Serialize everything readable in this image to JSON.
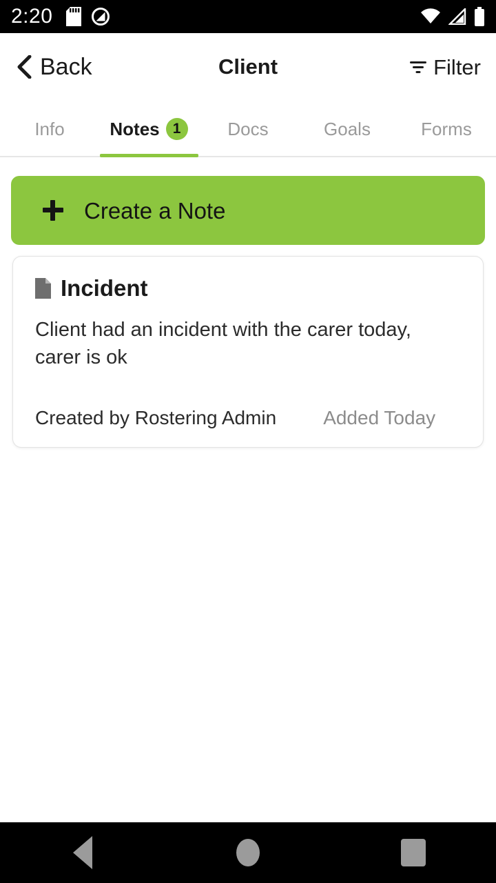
{
  "statusbar": {
    "time": "2:20",
    "left_icons": [
      {
        "name": "sd-card-icon"
      },
      {
        "name": "do-not-disturb-icon"
      }
    ],
    "right_icons": [
      {
        "name": "wifi-icon"
      },
      {
        "name": "cellular-signal-icon"
      },
      {
        "name": "battery-icon"
      }
    ]
  },
  "header": {
    "back_label": "Back",
    "title": "Client",
    "filter_label": "Filter"
  },
  "tabs": [
    {
      "label": "Info",
      "active": false,
      "badge": null
    },
    {
      "label": "Notes",
      "active": true,
      "badge": "1"
    },
    {
      "label": "Docs",
      "active": false,
      "badge": null
    },
    {
      "label": "Goals",
      "active": false,
      "badge": null
    },
    {
      "label": "Forms",
      "active": false,
      "badge": null
    }
  ],
  "main": {
    "create_button_label": "Create a Note",
    "notes": [
      {
        "title": "Incident",
        "body": "Client had an incident with the carer today, carer is ok",
        "author": "Created by Rostering Admin",
        "added": "Added Today"
      }
    ]
  },
  "navbar": {
    "back": "back",
    "home": "home",
    "recents": "recents"
  },
  "colors": {
    "accent_green": "#8CC63F",
    "text_primary": "#1b1b1b",
    "text_muted": "#9a9a9a",
    "card_border": "#e2e2e2",
    "statusbar_bg": "#000000"
  }
}
